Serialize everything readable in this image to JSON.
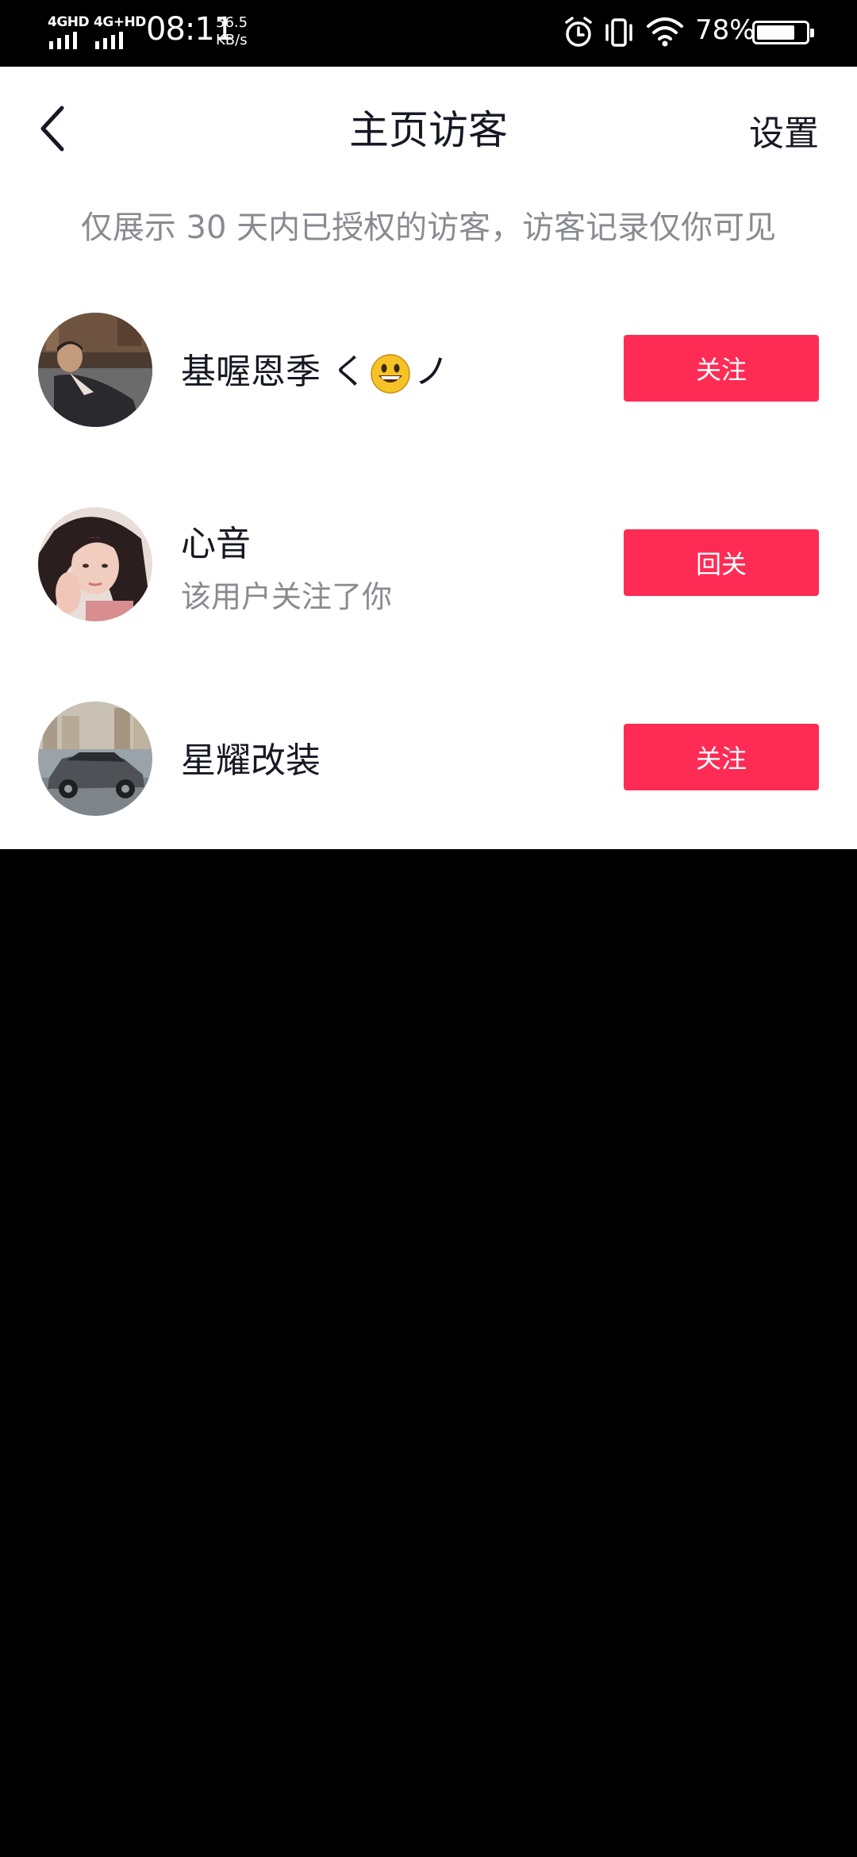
{
  "status_bar": {
    "signal1": "4GHD",
    "signal2": "4G+HD",
    "time": "08:11",
    "speed_value": "56.5",
    "speed_unit": "KB/s",
    "battery_percent": "78%",
    "battery_level": 0.78
  },
  "header": {
    "title": "主页访客",
    "settings_label": "设置"
  },
  "notice": "仅展示 30 天内已授权的访客，访客记录仅你可见",
  "visitors": [
    {
      "name_prefix": "基喔恩季",
      "name_left": "く",
      "name_right": "ノ",
      "subtitle": "",
      "button_label": "关注"
    },
    {
      "name": "心音",
      "subtitle": "该用户关注了你",
      "button_label": "回关"
    },
    {
      "name": "星耀改装",
      "subtitle": "",
      "button_label": "关注"
    }
  ],
  "colors": {
    "accent": "#fe2c55",
    "title_text": "#161823",
    "secondary_text": "#8a8b91"
  }
}
